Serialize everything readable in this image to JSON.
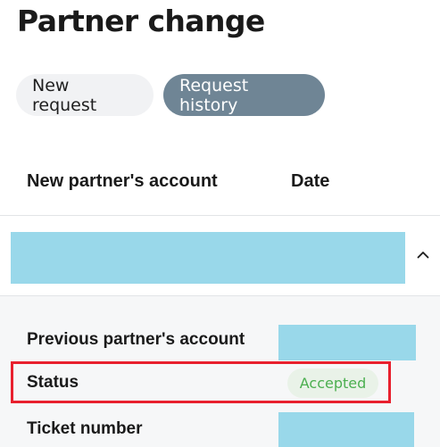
{
  "page": {
    "title": "Partner change"
  },
  "tabs": [
    {
      "label": "New request",
      "active": false
    },
    {
      "label": "Request history",
      "active": true
    }
  ],
  "table": {
    "headers": {
      "account": "New partner's account",
      "date": "Date"
    },
    "row": {
      "expanded": true,
      "expand_icon": "chevron-up-icon"
    }
  },
  "details": {
    "previous_account_label": "Previous partner's account",
    "status_label": "Status",
    "status_value": "Accepted",
    "ticket_label": "Ticket number"
  },
  "colors": {
    "active_tab": "#6f8595",
    "inactive_tab": "#f1f2f4",
    "status_accepted_text": "#4caf50",
    "status_accepted_bg": "#e9f2e8",
    "redaction": "#99d8ea",
    "highlight": "#e8202e"
  }
}
